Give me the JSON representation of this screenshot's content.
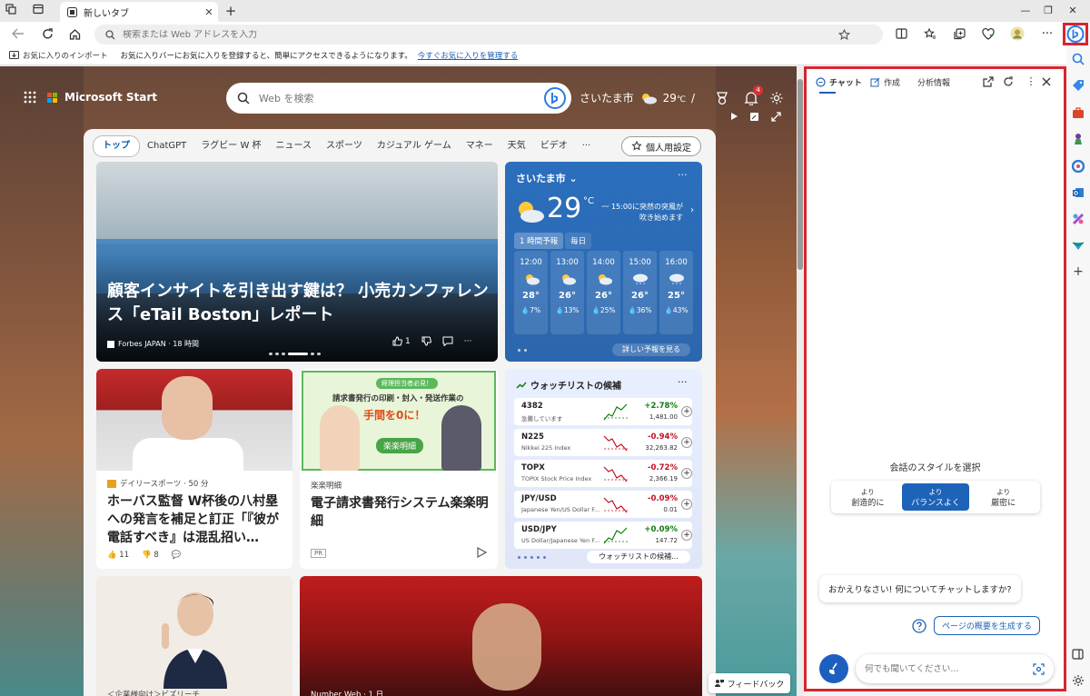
{
  "browser": {
    "tab_title": "新しいタブ",
    "address_placeholder": "検索または Web アドレスを入力"
  },
  "favbar": {
    "import_label": "お気に入りのインポート",
    "message": "お気に入りバーにお気に入りを登録すると、簡単にアクセスできるようになります。",
    "manage_link": "今すぐお気に入りを管理する"
  },
  "start": {
    "brand": "Microsoft Start",
    "search_placeholder": "Web を検索",
    "city": "さいたま市",
    "temp": "29",
    "temp_unit": "℃",
    "notification_count": "4",
    "nav_tabs": [
      "トップ",
      "ChatGPT",
      "ラグビー W 杯",
      "ニュース",
      "スポーツ",
      "カジュアル ゲーム",
      "マネー",
      "天気",
      "ビデオ",
      "···"
    ],
    "personalize_label": "個人用設定",
    "feedback_label": "フィードバック"
  },
  "hero": {
    "headline": "顧客インサイトを引き出す鍵は？ 小売カンファレンス「eTail Boston」レポート",
    "source": "Forbes JAPAN · 18 時間",
    "likes": "1"
  },
  "weather": {
    "city": "さいたま市",
    "temp": "29",
    "unit": "°C",
    "alert": "15:00に突然の突風が吹き始めます",
    "tabs": [
      "1 時間予報",
      "毎日"
    ],
    "hours": [
      {
        "time": "12:00",
        "temp": "28°",
        "precip": "7%",
        "icon": "partly-cloudy-icon"
      },
      {
        "time": "13:00",
        "temp": "26°",
        "precip": "13%",
        "icon": "partly-cloudy-icon"
      },
      {
        "time": "14:00",
        "temp": "26°",
        "precip": "25%",
        "icon": "partly-cloudy-icon"
      },
      {
        "time": "15:00",
        "temp": "26°",
        "precip": "36%",
        "icon": "rain-cloud-icon"
      },
      {
        "time": "16:00",
        "temp": "25°",
        "precip": "43%",
        "icon": "rain-cloud-icon"
      }
    ],
    "detail_label": "詳しい予報を見る"
  },
  "news2": {
    "source": "デイリースポーツ · 50 分",
    "title": "ホーバス監督 W杯後の八村塁への発言を補足と訂正「『彼が電話すべき』は混乱招い…",
    "likes": "11",
    "dislikes": "8"
  },
  "news3": {
    "badge": "経理担当者必見！",
    "copy1": "請求書発行の印刷・封入・発送作業の",
    "copy2": "手間を0に！",
    "brand": "楽楽明細",
    "source": "楽楽明細",
    "title": "電子請求書発行システム楽楽明細",
    "pr": "PR"
  },
  "watchlist": {
    "title": "ウォッチリストの候補",
    "rows": [
      {
        "symbol": "4382",
        "name": "急騰しています",
        "change": "+2.78%",
        "price": "1,481.00",
        "up": true
      },
      {
        "symbol": "N225",
        "name": "Nikkei 225 Index",
        "change": "-0.94%",
        "price": "32,263.82",
        "up": false
      },
      {
        "symbol": "TOPX",
        "name": "TOPIX Stock Price Index",
        "change": "-0.72%",
        "price": "2,366.19",
        "up": false
      },
      {
        "symbol": "JPY/USD",
        "name": "Japanese Yen/US Dollar F...",
        "change": "-0.09%",
        "price": "0.01",
        "up": false
      },
      {
        "symbol": "USD/JPY",
        "name": "US Dollar/Japanese Yen F...",
        "change": "+0.09%",
        "price": "147.72",
        "up": true
      }
    ],
    "footer": "ウォッチリストの候補..."
  },
  "news4": {
    "source": "＜企業様向け＞ビズリーチ"
  },
  "news5": {
    "source": "Number Web · 1 日"
  },
  "copilot": {
    "tabs": [
      "チャット",
      "作成",
      "分析情報"
    ],
    "style_title": "会話のスタイルを選択",
    "styles": [
      {
        "prefix": "より",
        "label": "創造的に"
      },
      {
        "prefix": "より",
        "label": "バランスよく"
      },
      {
        "prefix": "より",
        "label": "厳密に"
      }
    ],
    "greeting": "おかえりなさい! 何についてチャットしますか?",
    "summary_label": "ページの概要を生成する",
    "input_placeholder": "何でも聞いてください..."
  },
  "colors": {
    "accent": "#1d63b8",
    "highlight_red": "#d7262e",
    "up_green": "#107c10",
    "down_red": "#c50f1f"
  }
}
